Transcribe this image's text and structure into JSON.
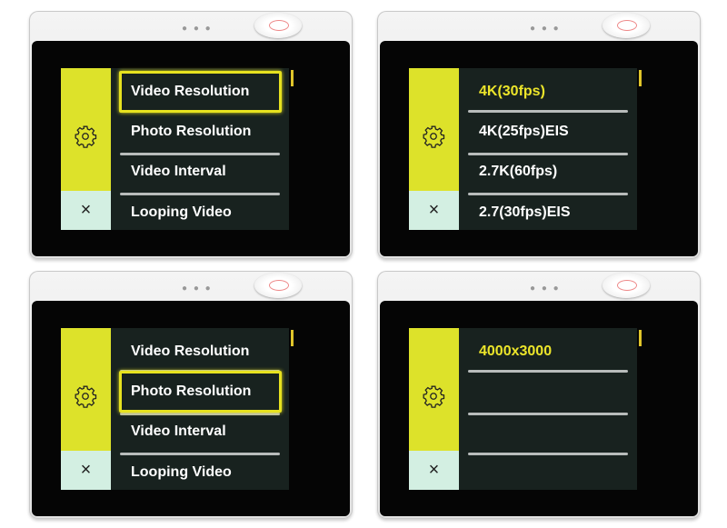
{
  "colors": {
    "sidebar_accent": "#dde22a",
    "sidebar_close": "#d3efe2",
    "selected_text": "#ece52a",
    "highlight_border": "#e7e21f"
  },
  "cameras": [
    {
      "sidebar": {
        "icon": "gear-icon",
        "close_icon": "close-icon",
        "close_label": "×"
      },
      "highlight_index": 0,
      "selected_index": -1,
      "items": [
        "Video Resolution",
        "Photo Resolution",
        "Video Interval",
        "Looping Video"
      ]
    },
    {
      "sidebar": {
        "icon": "gear-icon",
        "close_icon": "close-icon",
        "close_label": "×"
      },
      "highlight_index": -1,
      "selected_index": 0,
      "items": [
        "4K(30fps)",
        "4K(25fps)EIS",
        "2.7K(60fps)",
        "2.7(30fps)EIS"
      ]
    },
    {
      "sidebar": {
        "icon": "gear-icon",
        "close_icon": "close-icon",
        "close_label": "×"
      },
      "highlight_index": 1,
      "selected_index": -1,
      "items": [
        "Video Resolution",
        "Photo Resolution",
        "Video Interval",
        "Looping Video"
      ]
    },
    {
      "sidebar": {
        "icon": "gear-icon",
        "close_icon": "close-icon",
        "close_label": "×"
      },
      "highlight_index": -1,
      "selected_index": 0,
      "items": [
        "4000x3000",
        "",
        "",
        ""
      ]
    }
  ]
}
